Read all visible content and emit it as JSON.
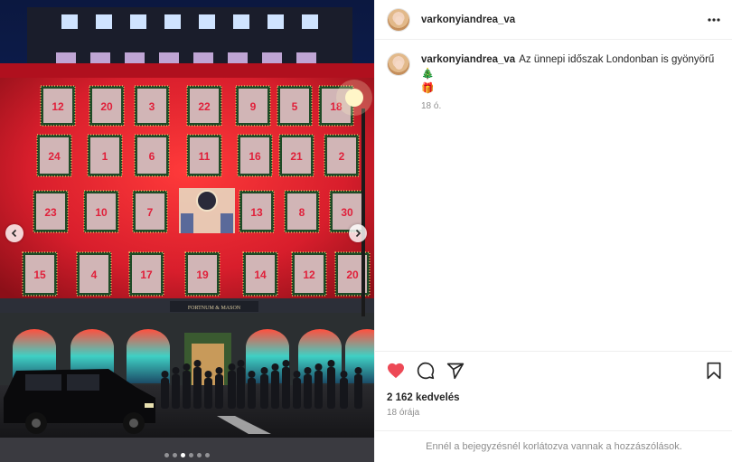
{
  "post": {
    "username": "varkonyiandrea_va",
    "caption_text": "Az ünnepi időszak Londonban is gyönyörű 🎄",
    "caption_emoji": "🎁",
    "caption_time": "18 ó.",
    "likes": "2 162 kedvelés",
    "posted_ago": "18 órája",
    "comments_restricted": "Ennél a bejegyzésnél korlátozva vannak a hozzászólások."
  },
  "photo": {
    "sign_text": "FORTNUM & MASON",
    "advent_numbers": [
      "12",
      "20",
      "3",
      "22",
      "9",
      "5",
      "18",
      "24",
      "1",
      "6",
      "11",
      "16",
      "21",
      "2",
      "23",
      "10",
      "7",
      "13",
      "8",
      "30",
      "15",
      "4",
      "17",
      "19",
      "14"
    ],
    "carousel": {
      "total": 6,
      "active": 2
    }
  },
  "icons": {
    "more": "more-horizontal-icon",
    "like": "heart-filled-icon",
    "comment": "comment-bubble-icon",
    "share": "paper-plane-icon",
    "save": "bookmark-icon",
    "prev": "chevron-left-icon",
    "next": "chevron-right-icon"
  },
  "colors": {
    "like_red": "#ed4956",
    "building_red": "#d81e2c",
    "muted": "#8e8e8e"
  }
}
